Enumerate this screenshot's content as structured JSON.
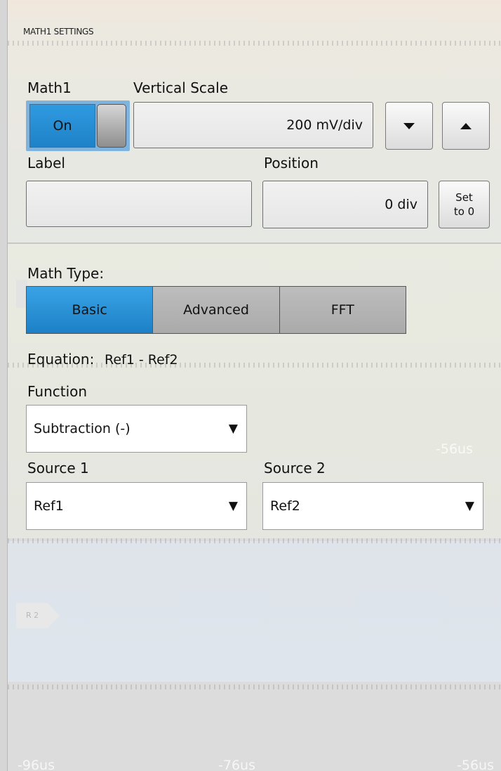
{
  "panel": {
    "title": "MATH1 SETTINGS"
  },
  "math1": {
    "label": "Math1",
    "toggle_state": "On"
  },
  "vertical_scale": {
    "label": "Vertical Scale",
    "value": "200 mV/div",
    "down_icon": "triangle-down",
    "up_icon": "triangle-up"
  },
  "label_field": {
    "label": "Label",
    "value": ""
  },
  "position": {
    "label": "Position",
    "value": "0 div",
    "set_zero_line1": "Set",
    "set_zero_line2": "to 0"
  },
  "math_type": {
    "label": "Math Type:",
    "options": [
      "Basic",
      "Advanced",
      "FFT"
    ],
    "selected": "Basic"
  },
  "equation": {
    "label": "Equation:",
    "value": "Ref1 - Ref2"
  },
  "function": {
    "label": "Function",
    "value": "Subtraction (-)"
  },
  "source1": {
    "label": "Source 1",
    "value": "Ref1"
  },
  "source2": {
    "label": "Source 2",
    "value": "Ref2"
  },
  "background_labels": {
    "time_mid": "-56us",
    "marker": "R 2",
    "time_bl": "-96us",
    "time_bc": "-76us",
    "time_br": "-56us"
  },
  "colors": {
    "accent_blue": "#1f86cc",
    "panel_gray": "#dcdcdc"
  }
}
